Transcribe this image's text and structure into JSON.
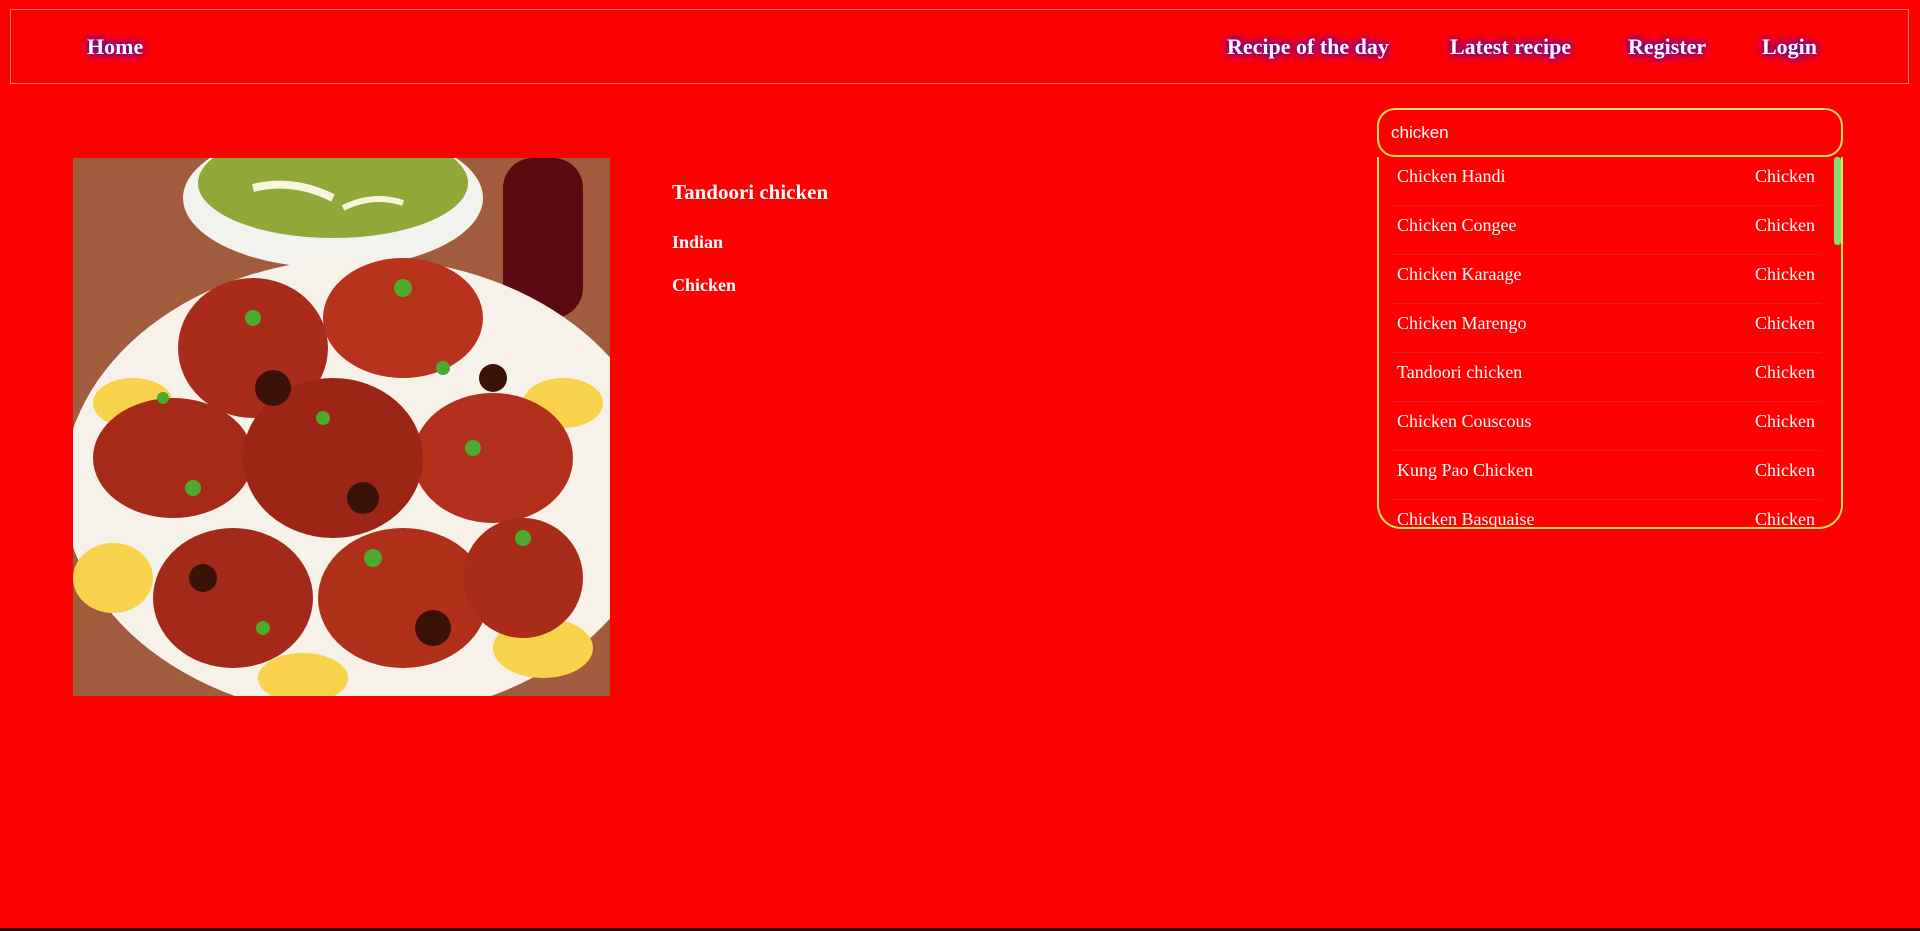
{
  "nav": {
    "home": "Home",
    "recipe_of_the_day": "Recipe of the day",
    "latest_recipe": "Latest recipe",
    "register": "Register",
    "login": "Login"
  },
  "recipe": {
    "title": "Tandoori chicken",
    "area": "Indian",
    "category": "Chicken",
    "image_icon": "tandoori-chicken-photo"
  },
  "search": {
    "value": "chicken",
    "placeholder": ""
  },
  "results": [
    {
      "name": "Chicken Handi",
      "category": "Chicken"
    },
    {
      "name": "Chicken Congee",
      "category": "Chicken"
    },
    {
      "name": "Chicken Karaage",
      "category": "Chicken"
    },
    {
      "name": "Chicken Marengo",
      "category": "Chicken"
    },
    {
      "name": "Tandoori chicken",
      "category": "Chicken"
    },
    {
      "name": "Chicken Couscous",
      "category": "Chicken"
    },
    {
      "name": "Kung Pao Chicken",
      "category": "Chicken"
    },
    {
      "name": "Chicken Basquaise",
      "category": "Chicken"
    }
  ],
  "colors": {
    "background": "#ff0000",
    "search_border": "#f5e04a",
    "scrollbar": "#7ee070",
    "nav_glow": "#6a00a0"
  }
}
